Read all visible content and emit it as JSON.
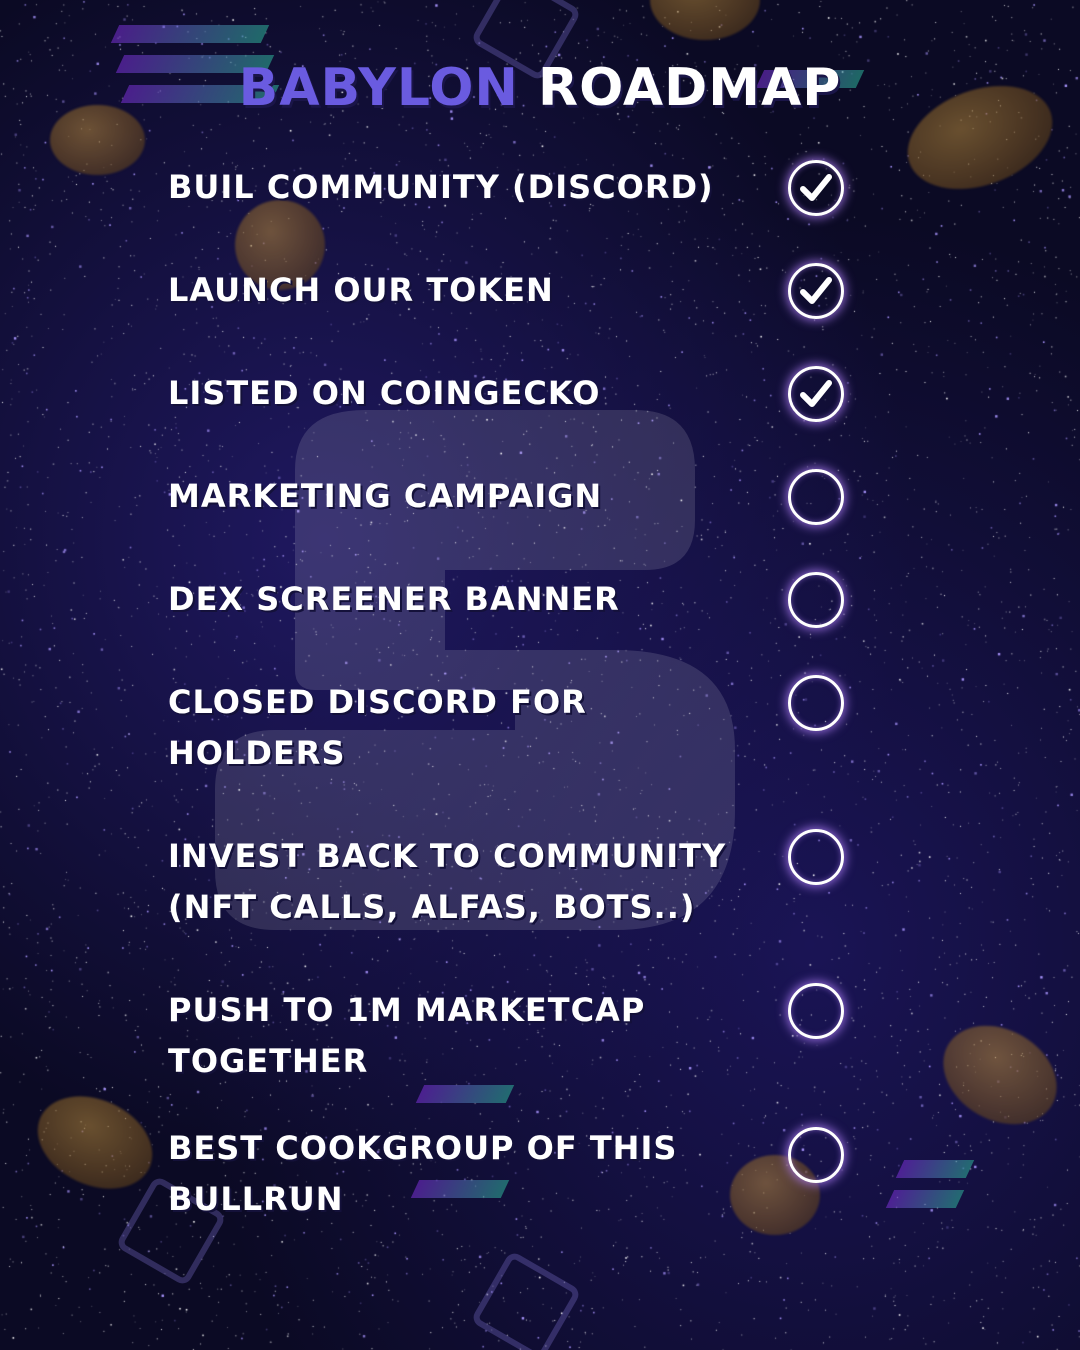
{
  "title": {
    "part1": "BABYLON",
    "part2": "ROADMAP"
  },
  "items": [
    {
      "label": "BUIL COMMUNITY (DISCORD)",
      "done": true
    },
    {
      "label": "LAUNCH OUR TOKEN",
      "done": true
    },
    {
      "label": "LISTED ON COINGECKO",
      "done": true
    },
    {
      "label": "MARKETING CAMPAIGN",
      "done": false
    },
    {
      "label": "DEX SCREENER BANNER",
      "done": false
    },
    {
      "label": "CLOSED DISCORD FOR HOLDERS",
      "done": false
    },
    {
      "label": "INVEST BACK TO COMMUNITY (NFT CALLS, ALFAS, BOTS..)",
      "done": false
    },
    {
      "label": "PUSH TO 1M MARKETCAP TOGETHER",
      "done": false
    },
    {
      "label": "BEST COOKGROUP OF THIS BULLRUN",
      "done": false
    }
  ],
  "colors": {
    "accent": "#6a5be0",
    "text": "#ffffff",
    "glow": "#b482ff",
    "background": "#0b0a24"
  },
  "icons": {
    "done": "check-circle-icon",
    "pending": "empty-circle-icon"
  }
}
